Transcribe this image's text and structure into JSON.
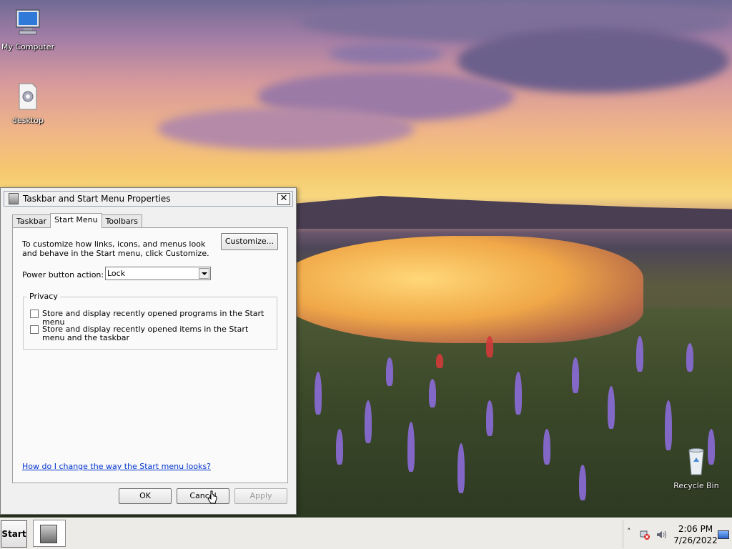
{
  "desktop": {
    "icons": [
      {
        "label": "My Computer",
        "icon": "computer-icon"
      },
      {
        "label": "desktop",
        "icon": "settings-file-icon"
      },
      {
        "label": "Recycle Bin",
        "icon": "recycle-bin-icon"
      }
    ]
  },
  "dialog": {
    "title": "Taskbar and Start Menu Properties",
    "close_glyph": "✕",
    "tabs": [
      {
        "label": "Taskbar",
        "active": false
      },
      {
        "label": "Start Menu",
        "active": true
      },
      {
        "label": "Toolbars",
        "active": false
      }
    ],
    "description": "To customize how links, icons, and menus look and behave in the Start menu, click Customize.",
    "customize_label": "Customize...",
    "power_button_label": "Power button action:",
    "power_button_value": "Lock",
    "privacy": {
      "title": "Privacy",
      "options": [
        {
          "label": "Store and display recently opened programs in the Start menu",
          "checked": false
        },
        {
          "label": "Store and display recently opened items in the Start menu and the taskbar",
          "checked": false
        }
      ]
    },
    "help_link": "How do I change the way the Start menu looks?",
    "buttons": {
      "ok": "OK",
      "cancel": "Cancel",
      "apply": "Apply"
    }
  },
  "taskbar": {
    "start_label": "Start",
    "clock_time": "2:06 PM",
    "clock_date": "7/26/2022",
    "tray_icons": [
      "chevron-up-icon",
      "network-error-icon",
      "speaker-icon",
      "show-desktop-icon"
    ]
  },
  "colors": {
    "link": "#0033cc",
    "dialog_bg": "#f0f0f0",
    "taskbar_bg": "#ecebe7"
  }
}
